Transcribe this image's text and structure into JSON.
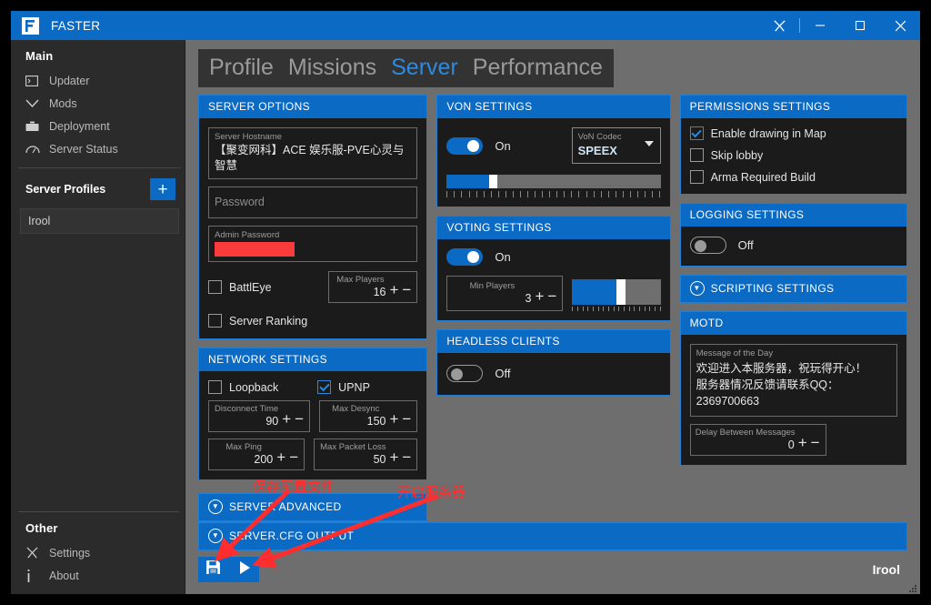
{
  "window": {
    "app_title": "FASTER",
    "logo_icon": "f-logo-icon",
    "titlebar_buttons": [
      {
        "name": "tools-icon",
        "glyph": "⚒"
      },
      {
        "name": "minimize-icon",
        "glyph": "–"
      },
      {
        "name": "maximize-icon",
        "glyph": "□"
      },
      {
        "name": "close-icon",
        "glyph": "✕"
      }
    ]
  },
  "sidebar": {
    "main_header": "Main",
    "main_items": [
      {
        "label": "Updater",
        "icon": "console-icon"
      },
      {
        "label": "Mods",
        "icon": "chevron-down-icon"
      },
      {
        "label": "Deployment",
        "icon": "briefcase-icon"
      },
      {
        "label": "Server Status",
        "icon": "gauge-icon"
      }
    ],
    "profiles_header": "Server Profiles",
    "add_profile_glyph": "+",
    "profiles": [
      "Irool"
    ],
    "other_header": "Other",
    "other_items": [
      {
        "label": "Settings",
        "icon": "tools-icon"
      },
      {
        "label": "About",
        "icon": "info-icon"
      }
    ]
  },
  "tabs": [
    {
      "label": "Profile",
      "active": false
    },
    {
      "label": "Missions",
      "active": false
    },
    {
      "label": "Server",
      "active": true
    },
    {
      "label": "Performance",
      "active": false
    }
  ],
  "server_options": {
    "title": "SERVER OPTIONS",
    "hostname": {
      "label": "Server Hostname",
      "value": "【聚变网科】ACE 娱乐服-PVE心灵与智慧"
    },
    "password": {
      "placeholder": "Password",
      "value": ""
    },
    "admin_password": {
      "label": "Admin Password",
      "value": "",
      "redacted": true,
      "redaction_color": "#f93b3b"
    },
    "battleye": {
      "label": "BattlEye",
      "checked": false
    },
    "server_ranking": {
      "label": "Server Ranking",
      "checked": false
    },
    "max_players": {
      "label": "Max Players",
      "value": "16",
      "plus": "+",
      "minus": "−"
    }
  },
  "network_settings": {
    "title": "NETWORK SETTINGS",
    "loopback": {
      "label": "Loopback",
      "checked": false
    },
    "upnp": {
      "label": "UPNP",
      "checked": true
    },
    "disconnect_time": {
      "label": "Disconnect Time",
      "value": "90"
    },
    "max_desync": {
      "label": "Max Desync",
      "value": "150"
    },
    "max_ping": {
      "label": "Max Ping",
      "value": "200"
    },
    "max_packet_loss": {
      "label": "Max Packet Loss",
      "value": "50"
    },
    "plus": "+",
    "minus": "−"
  },
  "server_advanced": {
    "title": "SERVER ADVANCED",
    "collapsed": true
  },
  "von_settings": {
    "title": "VON SETTINGS",
    "toggle": {
      "state": "On",
      "on": true
    },
    "codec": {
      "label": "VoN Codec",
      "value": "SPEEX"
    },
    "slider": {
      "percent": 20
    }
  },
  "voting_settings": {
    "title": "VOTING SETTINGS",
    "toggle": {
      "state": "On",
      "on": true
    },
    "min_players": {
      "label": "Min Players",
      "value": "3",
      "plus": "+",
      "minus": "−"
    },
    "slider": {
      "percent": 50
    }
  },
  "headless_clients": {
    "title": "HEADLESS CLIENTS",
    "toggle": {
      "state": "Off",
      "on": false
    }
  },
  "permissions_settings": {
    "title": "PERMISSIONS SETTINGS",
    "items": [
      {
        "label": "Enable drawing in Map",
        "checked": true
      },
      {
        "label": "Skip lobby",
        "checked": false
      },
      {
        "label": "Arma Required Build",
        "checked": false
      }
    ]
  },
  "logging_settings": {
    "title": "LOGGING SETTINGS",
    "toggle": {
      "state": "Off",
      "on": false
    }
  },
  "scripting_settings": {
    "title": "SCRIPTING SETTINGS",
    "collapsed": true
  },
  "motd": {
    "title": "MOTD",
    "label": "Message of the Day",
    "line1": "欢迎进入本服务器，祝玩得开心！",
    "line2": "服务器情况反馈请联系QQ：2369700663",
    "delay": {
      "label": "Delay Between Messages",
      "value": "0",
      "plus": "+",
      "minus": "−"
    }
  },
  "output_bar": {
    "title": "SERVER.CFG OUTPUT",
    "collapsed": true
  },
  "action_bar": {
    "save_icon": "save-floppy-icon",
    "play_icon": "play-icon",
    "profile_name": "Irool"
  },
  "annotations": [
    {
      "text": "保存配置文件",
      "color": "#ff2d2d"
    },
    {
      "text": "开启服务器",
      "color": "#ff2d2d"
    }
  ],
  "colors": {
    "accent": "#0b6ac4",
    "panel_bg": "#1b1b1b",
    "window_bg": "#6e6e6e",
    "sidebar_bg": "#2b2b2b",
    "annotation": "#ff2d2d"
  }
}
